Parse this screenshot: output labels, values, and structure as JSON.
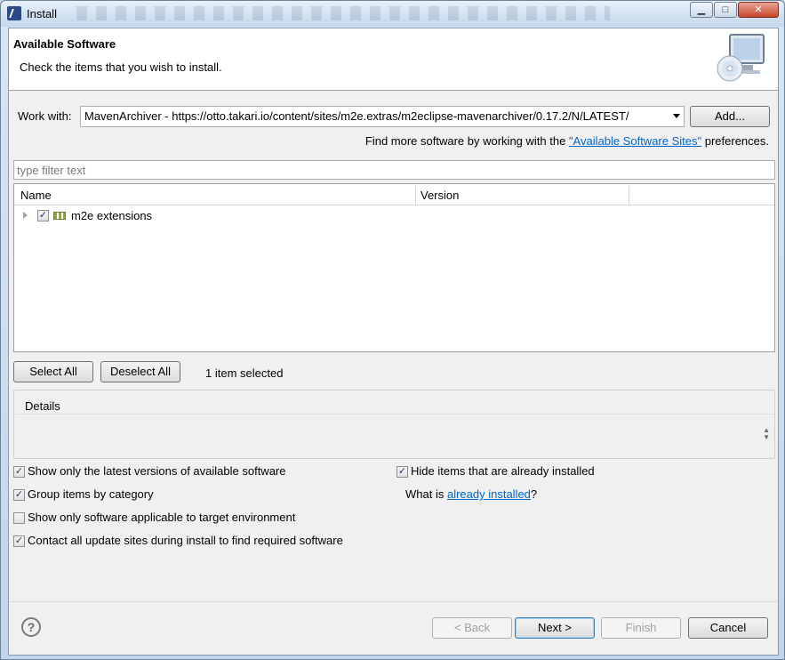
{
  "window": {
    "title": "Install",
    "minimize_label": "▁",
    "maximize_label": "□",
    "close_label": "✕"
  },
  "header": {
    "title": "Available Software",
    "subtitle": "Check the items that you wish to install."
  },
  "work_with": {
    "label": "Work with:",
    "value": "MavenArchiver - https://otto.takari.io/content/sites/m2e.extras/m2eclipse-mavenarchiver/0.17.2/N/LATEST/",
    "add_button": "Add...",
    "find_more_prefix": "Find more software by working with the ",
    "find_more_link": "\"Available Software Sites\"",
    "find_more_suffix": " preferences."
  },
  "filter": {
    "placeholder": "type filter text"
  },
  "tree": {
    "columns": [
      "Name",
      "Version"
    ],
    "rows": [
      {
        "label": "m2e extensions",
        "checked": true,
        "version": ""
      }
    ]
  },
  "selection": {
    "select_all": "Select All",
    "deselect_all": "Deselect All",
    "count_text": "1 item selected"
  },
  "details": {
    "legend": "Details"
  },
  "options": {
    "latest_versions": {
      "label": "Show only the latest versions of available software",
      "checked": true
    },
    "group_by_category": {
      "label": "Group items by category",
      "checked": true
    },
    "target_env": {
      "label": "Show only software applicable to target environment",
      "checked": false
    },
    "contact_sites": {
      "label": "Contact all update sites during install to find required software",
      "checked": true
    },
    "hide_installed": {
      "label": "Hide items that are already installed",
      "checked": true
    },
    "what_is_prefix": "What is ",
    "what_is_link": "already installed",
    "what_is_suffix": "?"
  },
  "footer": {
    "help": "?",
    "back": "< Back",
    "next": "Next >",
    "finish": "Finish",
    "cancel": "Cancel"
  },
  "colors": {
    "link": "#0066cc",
    "title_gradient_top": "#e9f1fa",
    "dialog_bg": "#f0f0f0"
  }
}
